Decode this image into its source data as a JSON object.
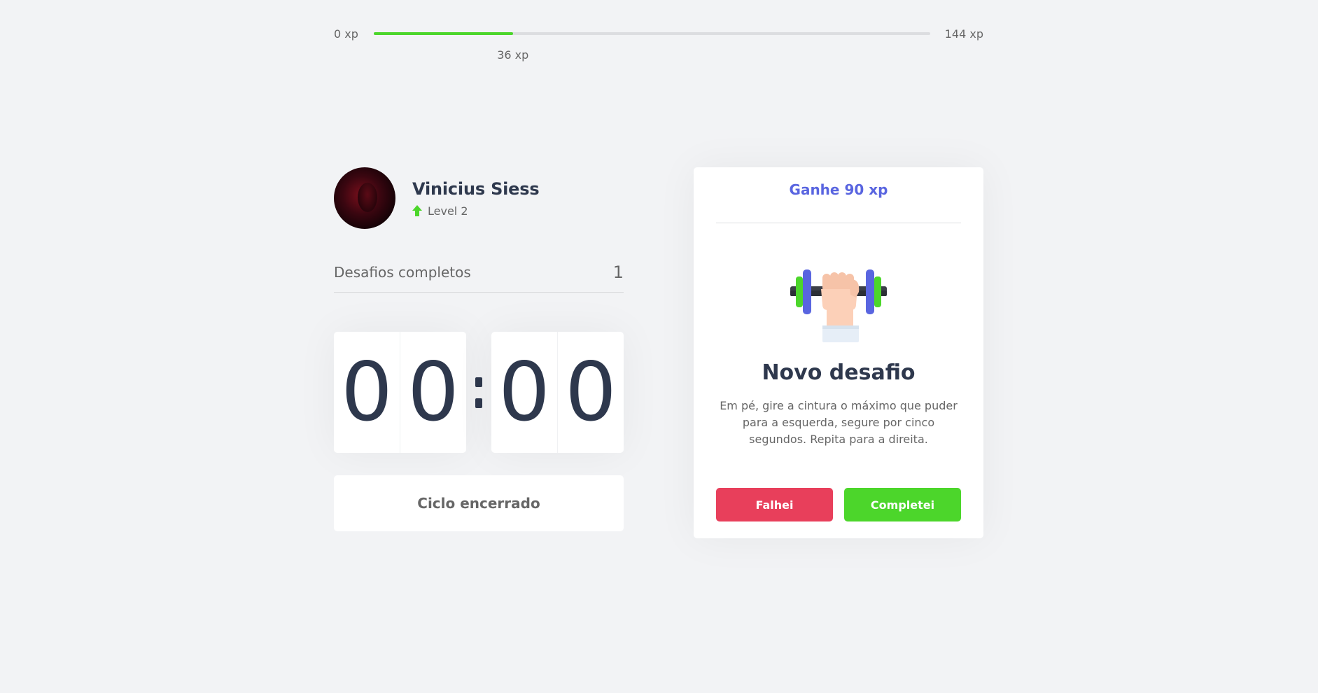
{
  "xp": {
    "min_label": "0 xp",
    "max_label": "144 xp",
    "current_label": "36 xp",
    "current": 36,
    "max": 144,
    "colors": {
      "fill": "#4cd62b",
      "track": "#dcdde0"
    }
  },
  "profile": {
    "name": "Vinicius Siess",
    "level_label": "Level 2",
    "level_icon": "level-up-arrow-icon"
  },
  "stats": {
    "completed_label": "Desafios completos",
    "completed_count": "1"
  },
  "countdown": {
    "minute_left": "0",
    "minute_right": "0",
    "separator": ":",
    "second_left": "0",
    "second_right": "0"
  },
  "cycle_button": {
    "label": "Ciclo encerrado"
  },
  "challenge": {
    "header": "Ganhe 90 xp",
    "image": "dumbbell-icon",
    "title": "Novo desafio",
    "description": "Em pé, gire a cintura o máximo que puder para a esquerda, segure por cinco segundos. Repita para a direita.",
    "fail_label": "Falhei",
    "success_label": "Completei"
  },
  "colors": {
    "background": "#f2f3f5",
    "title": "#2e384d",
    "text": "#666666",
    "blue": "#5965e0",
    "red": "#e83f5b",
    "green": "#4cd62b"
  }
}
